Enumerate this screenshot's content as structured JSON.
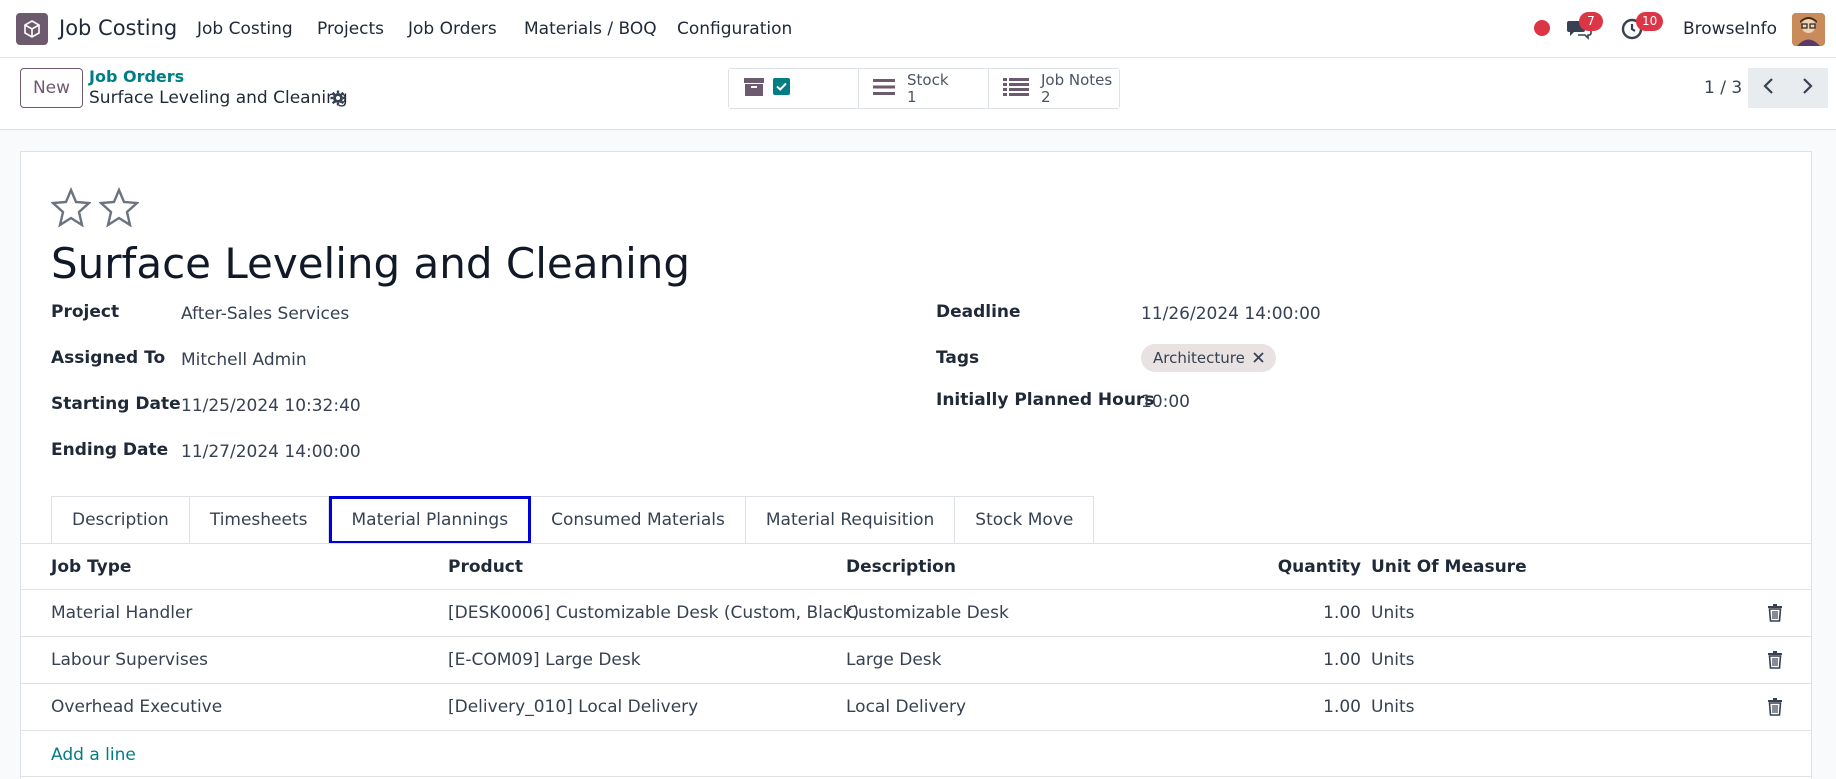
{
  "navbar": {
    "app_name": "Job Costing",
    "menu": [
      "Job Costing",
      "Projects",
      "Job Orders",
      "Materials / BOQ",
      "Configuration"
    ],
    "chat_count": "7",
    "activity_count": "10",
    "user": "BrowseInfo"
  },
  "control": {
    "new_label": "New",
    "breadcrumb_parent": "Job Orders",
    "breadcrumb_current": "Surface Leveling and Cleaning",
    "smart_buttons": [
      {
        "label": "Stock",
        "value": "1"
      },
      {
        "label": "Job Notes",
        "value": "2"
      }
    ],
    "pager": "1 / 3"
  },
  "form": {
    "title": "Surface Leveling and Cleaning",
    "left_fields": [
      {
        "label": "Project",
        "value": "After-Sales Services"
      },
      {
        "label": "Assigned To",
        "value": "Mitchell Admin"
      },
      {
        "label": "Starting Date",
        "value": "11/25/2024 10:32:40"
      },
      {
        "label": "Ending Date",
        "value": "11/27/2024 14:00:00"
      }
    ],
    "right_fields": [
      {
        "label": "Deadline",
        "value": "11/26/2024 14:00:00"
      },
      {
        "label": "Tags",
        "value": "Architecture"
      },
      {
        "label": "Initially Planned Hours",
        "value": "10:00"
      }
    ]
  },
  "tabs": [
    "Description",
    "Timesheets",
    "Material Plannings",
    "Consumed Materials",
    "Material Requisition",
    "Stock Move"
  ],
  "active_tab": "Material Plannings",
  "table": {
    "headers": [
      "Job Type",
      "Product",
      "Description",
      "Quantity",
      "Unit Of Measure"
    ],
    "rows": [
      [
        "Material Handler",
        "[DESK0006] Customizable Desk (Custom, Black)",
        "Customizable Desk",
        "1.00",
        "Units"
      ],
      [
        "Labour Supervises",
        "[E-COM09] Large Desk",
        "Large Desk",
        "1.00",
        "Units"
      ],
      [
        "Overhead Executive",
        "[Delivery_010] Local Delivery",
        "Local Delivery",
        "1.00",
        "Units"
      ]
    ],
    "add_line": "Add a line"
  },
  "colors": {
    "brand": "#6d5a6f",
    "link": "#017e84",
    "badge": "#dc3545",
    "highlight": "#0000dd"
  }
}
